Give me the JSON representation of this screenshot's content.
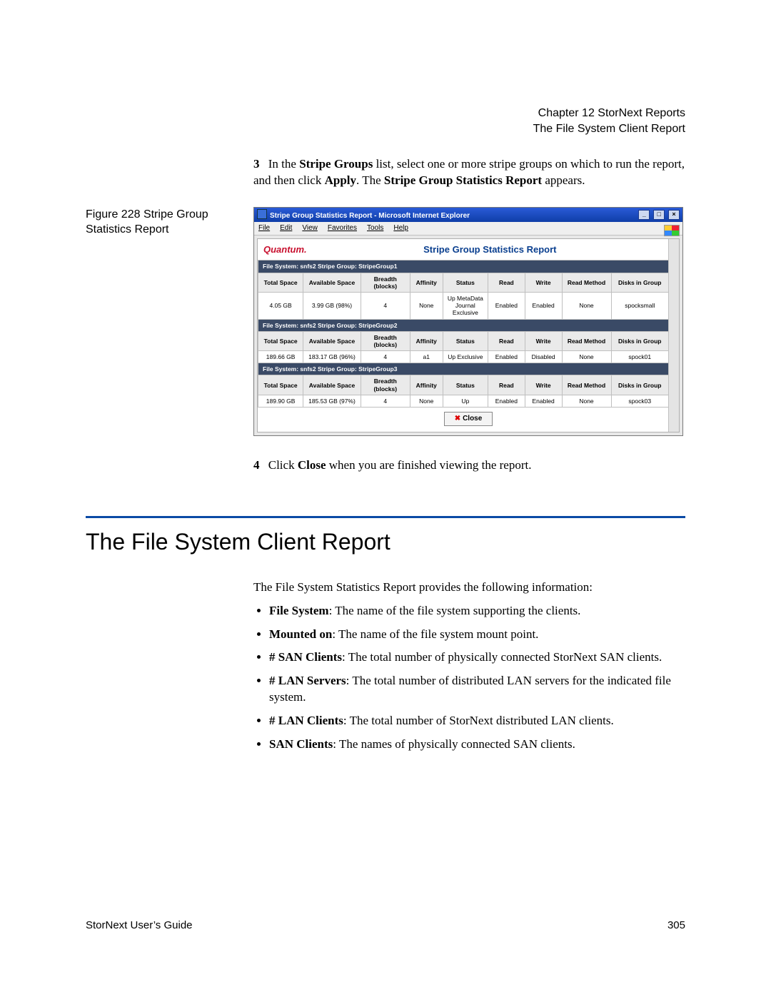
{
  "header": {
    "chapter": "Chapter 12  StorNext Reports",
    "subtitle": "The File System Client Report"
  },
  "step3": {
    "num": "3",
    "pre": "In the ",
    "b1": "Stripe Groups",
    "mid1": " list, select one or more stripe groups on which to run the report, and then click ",
    "b2": "Apply",
    "mid2": ". The ",
    "b3": "Stripe Group Statistics Report",
    "post": " appears."
  },
  "figure": {
    "label": "Figure 228  Stripe Group Statistics Report"
  },
  "ie": {
    "title": "Stripe Group Statistics Report - Microsoft Internet Explorer",
    "menu": [
      "File",
      "Edit",
      "View",
      "Favorites",
      "Tools",
      "Help"
    ],
    "brand": "Quantum.",
    "report_title": "Stripe Group Statistics Report",
    "columns": [
      "Total Space",
      "Available Space",
      "Breadth (blocks)",
      "Affinity",
      "Status",
      "Read",
      "Write",
      "Read Method",
      "Disks in Group"
    ],
    "groups": [
      {
        "section": "File System: snfs2    Stripe Group: StripeGroup1",
        "row": [
          "4.05 GB",
          "3.99 GB (98%)",
          "4",
          "None",
          "Up MetaData Journal Exclusive",
          "Enabled",
          "Enabled",
          "None",
          "spocksmall"
        ]
      },
      {
        "section": "File System: snfs2    Stripe Group: StripeGroup2",
        "row": [
          "189.66 GB",
          "183.17 GB (96%)",
          "4",
          "a1",
          "Up Exclusive",
          "Enabled",
          "Disabled",
          "None",
          "spock01"
        ]
      },
      {
        "section": "File System: snfs2    Stripe Group: StripeGroup3",
        "row": [
          "189.90 GB",
          "185.53 GB (97%)",
          "4",
          "None",
          "Up",
          "Enabled",
          "Enabled",
          "None",
          "spock03"
        ]
      }
    ],
    "close": "Close"
  },
  "step4": {
    "num": "4",
    "pre": "Click ",
    "b1": "Close",
    "post": " when you are finished viewing the report."
  },
  "heading": "The File System Client Report",
  "intro": "The File System Statistics Report provides the following information:",
  "bullets": [
    {
      "b": "File System",
      "t": ": The name of the file system supporting the clients."
    },
    {
      "b": "Mounted on",
      "t": ": The name of the file system mount point."
    },
    {
      "b": "# SAN Clients",
      "t": ": The total number of physically connected StorNext SAN clients."
    },
    {
      "b": "# LAN Servers",
      "t": ": The total number of distributed LAN servers for the indicated file system."
    },
    {
      "b": "# LAN Clients",
      "t": ": The total number of StorNext distributed LAN clients."
    },
    {
      "b": "SAN Clients",
      "t": ": The names of physically connected SAN clients."
    }
  ],
  "footer": {
    "left": "StorNext User’s Guide",
    "right": "305"
  }
}
